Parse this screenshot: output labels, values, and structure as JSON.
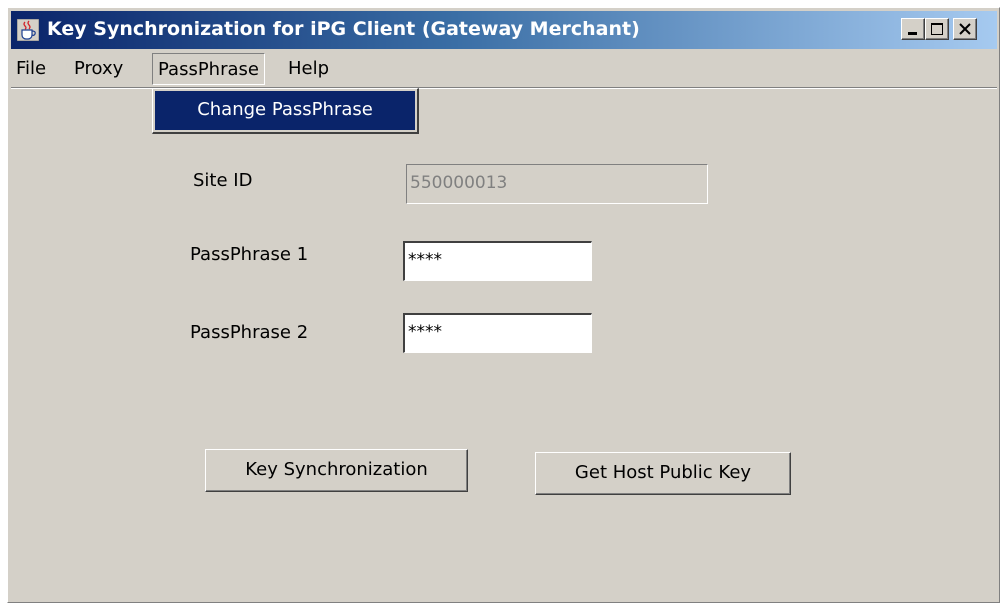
{
  "window": {
    "title": "Key Synchronization for iPG Client (Gateway Merchant)",
    "icon": "java-cup-icon",
    "controls": [
      "minimize-icon",
      "maximize-icon",
      "close-icon"
    ]
  },
  "menubar": {
    "items": [
      {
        "label": "File",
        "open": false
      },
      {
        "label": "Proxy",
        "open": false
      },
      {
        "label": "PassPhrase",
        "open": true
      },
      {
        "label": "Help",
        "open": false
      }
    ]
  },
  "dropdown": {
    "items": [
      {
        "label": "Change PassPhrase",
        "selected": true
      }
    ]
  },
  "form": {
    "site_id": {
      "label": "Site ID",
      "value": "550000013",
      "enabled": false
    },
    "passphrase1": {
      "label": "PassPhrase 1",
      "value": "****"
    },
    "passphrase2": {
      "label": "PassPhrase 2",
      "value": "****"
    }
  },
  "buttons": {
    "key_sync": "Key Synchronization",
    "get_host_key": "Get Host Public Key"
  },
  "colors": {
    "face": "#d4d0c8",
    "title_active": "#0a246a",
    "highlight": "#0a246a"
  }
}
